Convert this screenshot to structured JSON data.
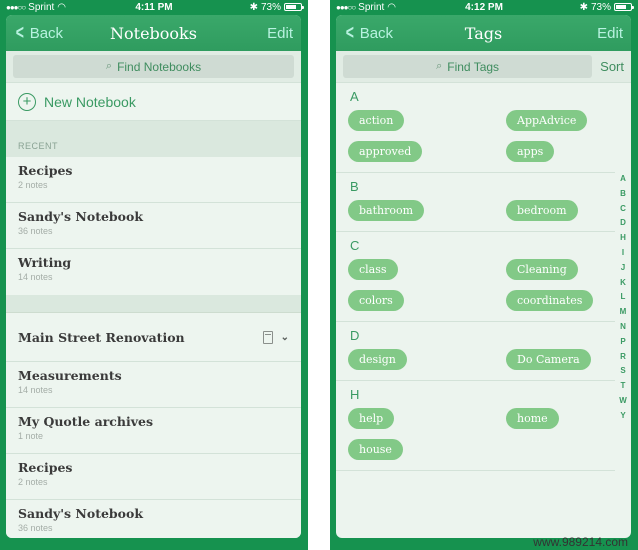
{
  "left": {
    "status": {
      "carrier": "Sprint",
      "signal_dots": "●●●○○",
      "time": "4:11 PM",
      "battery": "73%",
      "battery_level": 0.73
    },
    "nav": {
      "back": "Back",
      "title": "Notebooks",
      "edit": "Edit"
    },
    "search": {
      "placeholder": "Find Notebooks"
    },
    "new_notebook": "New Notebook",
    "recent_header": "RECENT",
    "recent": [
      {
        "title": "Recipes",
        "count": "2 notes"
      },
      {
        "title": "Sandy's Notebook",
        "count": "36 notes"
      },
      {
        "title": "Writing",
        "count": "14 notes"
      }
    ],
    "stack": {
      "title": "Main Street Renovation"
    },
    "notebooks": [
      {
        "title": "Measurements",
        "count": "14 notes"
      },
      {
        "title": "My Quotle archives",
        "count": "1 note"
      },
      {
        "title": "Recipes",
        "count": "2 notes"
      },
      {
        "title": "Sandy's Notebook",
        "count": "36 notes"
      }
    ]
  },
  "right": {
    "status": {
      "carrier": "Sprint",
      "signal_dots": "●●●○○",
      "time": "4:12 PM",
      "battery": "73%",
      "battery_level": 0.73
    },
    "nav": {
      "back": "Back",
      "title": "Tags",
      "edit": "Edit"
    },
    "search": {
      "placeholder": "Find Tags",
      "sort": "Sort"
    },
    "sections": [
      {
        "letter": "A",
        "tags": [
          "action",
          "AppAdvice",
          "approved",
          "apps"
        ]
      },
      {
        "letter": "B",
        "tags": [
          "bathroom",
          "bedroom"
        ]
      },
      {
        "letter": "C",
        "tags": [
          "class",
          "Cleaning",
          "colors",
          "coordinates"
        ]
      },
      {
        "letter": "D",
        "tags": [
          "design",
          "Do Camera"
        ]
      },
      {
        "letter": "H",
        "tags": [
          "help",
          "home",
          "house"
        ]
      }
    ],
    "index": [
      "A",
      "B",
      "C",
      "D",
      "H",
      "I",
      "J",
      "K",
      "L",
      "M",
      "N",
      "P",
      "R",
      "S",
      "T",
      "W",
      "Y"
    ]
  },
  "watermark": "www.989214.com"
}
